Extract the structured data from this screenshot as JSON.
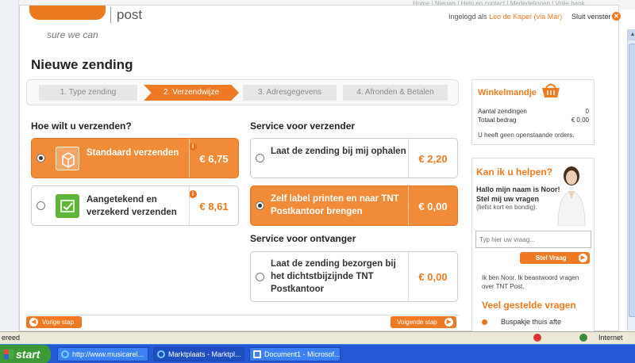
{
  "browser": {
    "bg_nav": "Home | Nieuws | Help en contact | Mededelingen | Vrijje bank",
    "status": "ereed",
    "zone": "Internet"
  },
  "header": {
    "brand": "post",
    "tagline": "sure we can",
    "login_prefix": "Ingelogd als",
    "login_user": "Leo de Kaper (via Mar)",
    "close_label": "Sluit venster"
  },
  "page": {
    "title": "Nieuwe zending"
  },
  "steps": [
    {
      "label": "1. Type zending",
      "active": false
    },
    {
      "label": "2. Verzendwijze",
      "active": true
    },
    {
      "label": "3. Adresgegevens",
      "active": false
    },
    {
      "label": "4. Afronden & Betalen",
      "active": false
    }
  ],
  "shipping": {
    "title": "Hoe wilt u verzenden?",
    "options": [
      {
        "label": "Standaard verzenden",
        "price": "€ 6,75",
        "selected": true
      },
      {
        "label_line1": "Aangetekend en",
        "label_line2": "verzekerd verzenden",
        "price": "€ 8,61",
        "selected": false
      }
    ]
  },
  "sender_service": {
    "title": "Service voor verzender",
    "options": [
      {
        "label": "Laat de zending bij mij ophalen",
        "price": "€ 2,20",
        "selected": false
      },
      {
        "label_line1": "Zelf label printen en naar TNT",
        "label_line2": "Postkantoor brengen",
        "price": "€ 0,00",
        "selected": true
      }
    ]
  },
  "receiver_service": {
    "title": "Service voor ontvanger",
    "options": [
      {
        "label_line1": "Laat de zending bezorgen bij",
        "label_line2": "het dichtstbijzijnde TNT",
        "label_line3": "Postkantoor",
        "price": "€ 0,00",
        "selected": false
      }
    ]
  },
  "nav": {
    "prev": "Vorige stap",
    "next": "Volgende stap"
  },
  "cart": {
    "title": "Winkelmandje",
    "rows": [
      {
        "label": "Aantal zendingen",
        "value": "0"
      },
      {
        "label": "Totaal bedrag",
        "value": "€ 0,00"
      }
    ],
    "note": "U heeft geen openstaande orders."
  },
  "help": {
    "title": "Kan ik u helpen?",
    "intro_line1": "Hallo mijn naam is Noor!",
    "intro_line2": "Stel mij uw vragen",
    "intro_sub": "(liefst kort en bondig).",
    "placeholder": "Typ hier uw vraag...",
    "ask_label": "Stel Vraag",
    "reply_line1": "Ik ben Noor. Ik beantwoord vragen",
    "reply_line2": "over TNT Post.",
    "faq_title": "Veel gestelde vragen",
    "faq_item": "Buspakje thuis afte"
  },
  "taskbar": {
    "start": "start",
    "tasks": [
      {
        "label": "http://www.musicarel...",
        "active": false
      },
      {
        "label": "Marktplaats - Marktpl...",
        "active": true
      },
      {
        "label": "Document1 - Microsof...",
        "active": false
      }
    ]
  },
  "colors": {
    "accent": "#f07a24",
    "text": "#333333"
  }
}
